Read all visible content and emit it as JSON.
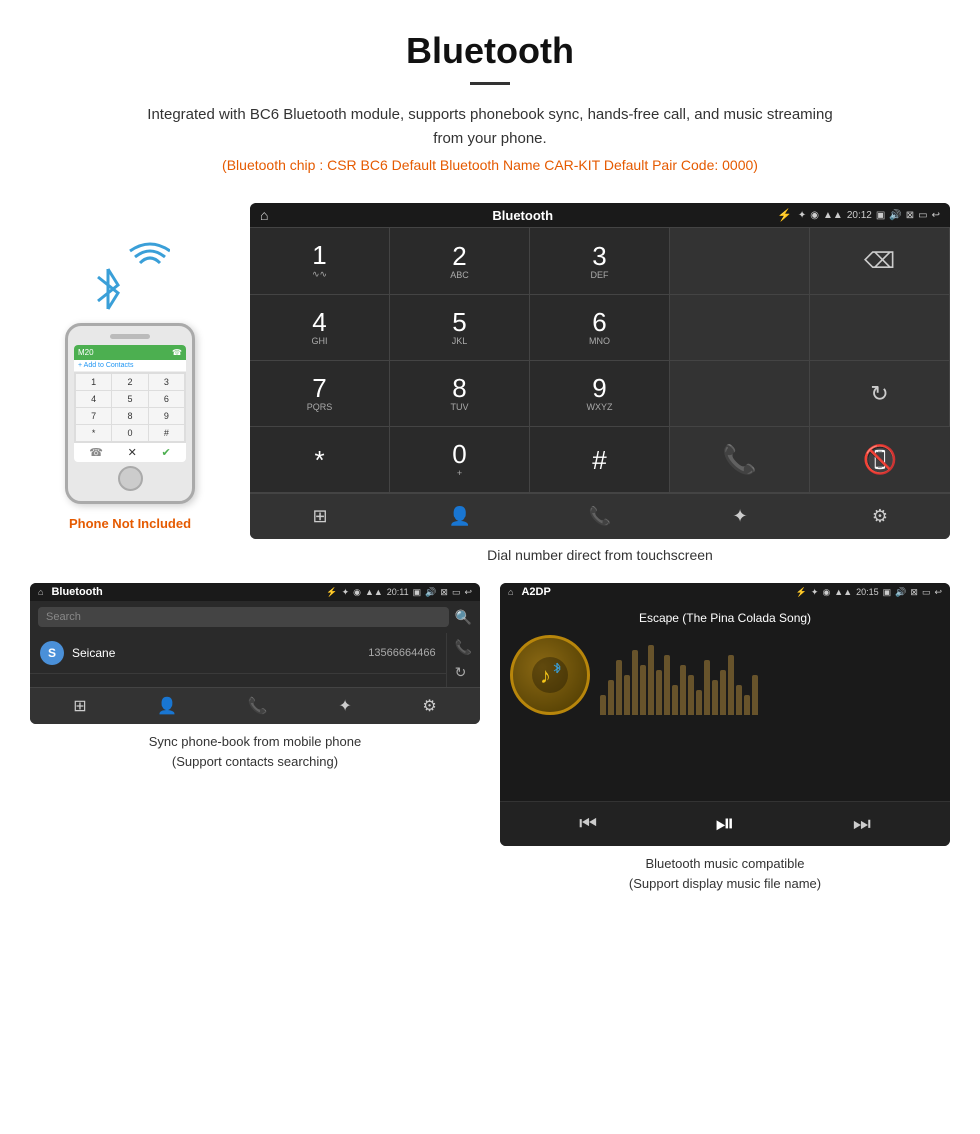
{
  "header": {
    "title": "Bluetooth",
    "description": "Integrated with BC6 Bluetooth module, supports phonebook sync, hands-free call, and music streaming from your phone.",
    "specs": "(Bluetooth chip : CSR BC6   Default Bluetooth Name CAR-KIT    Default Pair Code: 0000)"
  },
  "phone_label": "Phone Not Included",
  "main_screen": {
    "status_bar": {
      "home_icon": "⌂",
      "title": "Bluetooth",
      "usb_icon": "⚡",
      "bt_icon": "✦",
      "location_icon": "◉",
      "signal_icon": "▲",
      "time": "20:12",
      "camera_icon": "📷",
      "volume_icon": "🔊",
      "close_icon": "✕",
      "window_icon": "▭",
      "back_icon": "↩"
    },
    "dialpad": [
      {
        "number": "1",
        "letters": "∿∿",
        "row": 0,
        "col": 0
      },
      {
        "number": "2",
        "letters": "ABC",
        "row": 0,
        "col": 1
      },
      {
        "number": "3",
        "letters": "DEF",
        "row": 0,
        "col": 2
      },
      {
        "number": "4",
        "letters": "GHI",
        "row": 1,
        "col": 0
      },
      {
        "number": "5",
        "letters": "JKL",
        "row": 1,
        "col": 1
      },
      {
        "number": "6",
        "letters": "MNO",
        "row": 1,
        "col": 2
      },
      {
        "number": "7",
        "letters": "PQRS",
        "row": 2,
        "col": 0
      },
      {
        "number": "8",
        "letters": "TUV",
        "row": 2,
        "col": 1
      },
      {
        "number": "9",
        "letters": "WXYZ",
        "row": 2,
        "col": 2
      },
      {
        "number": "*",
        "letters": "",
        "row": 3,
        "col": 0
      },
      {
        "number": "0",
        "letters": "+",
        "row": 3,
        "col": 1
      },
      {
        "number": "#",
        "letters": "",
        "row": 3,
        "col": 2
      }
    ],
    "caption": "Dial number direct from touchscreen"
  },
  "phonebook_screen": {
    "title": "Bluetooth",
    "usb_icon": "⚡",
    "time": "20:11",
    "search_placeholder": "Search",
    "contact": {
      "letter": "S",
      "name": "Seicane",
      "number": "13566664466"
    },
    "caption_line1": "Sync phone-book from mobile phone",
    "caption_line2": "(Support contacts searching)"
  },
  "music_screen": {
    "title": "A2DP",
    "time": "20:15",
    "song_title": "Escape (The Pina Colada Song)",
    "bt_symbol": "♪",
    "caption_line1": "Bluetooth music compatible",
    "caption_line2": "(Support display music file name)"
  },
  "colors": {
    "orange": "#e55a00",
    "green": "#4caf50",
    "red": "#f44336",
    "blue": "#2196F3",
    "gold": "#b8860b"
  }
}
